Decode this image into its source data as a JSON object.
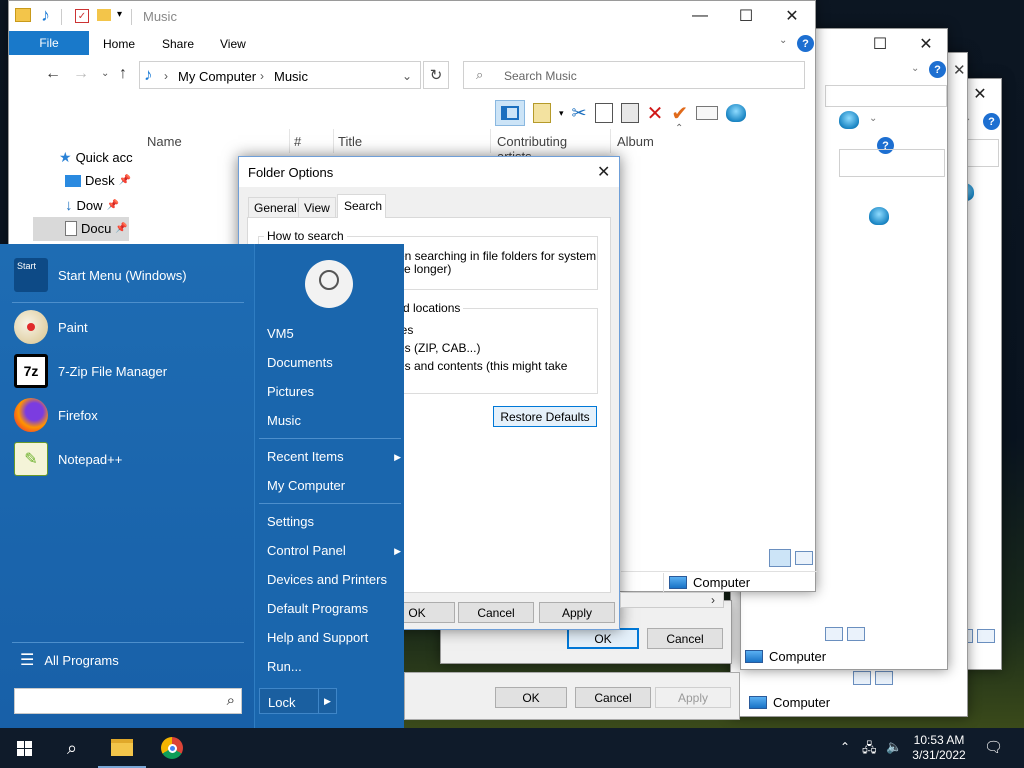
{
  "explorer": {
    "title": "Music",
    "menu": {
      "file": "File",
      "home": "Home",
      "share": "Share",
      "view": "View",
      "f": "F"
    },
    "breadcrumb": {
      "root": "My Computer",
      "current": "Music"
    },
    "search_placeholder": "Search Music",
    "columns": [
      "Name",
      "#",
      "Title",
      "Contributing artists",
      "Album"
    ],
    "nav": {
      "quick_access": "Quick acc",
      "desktop": "Desk",
      "downloads": "Dow",
      "documents": "Docu"
    },
    "status_computer": "Computer"
  },
  "back_windows": {
    "computer_1": "Computer",
    "computer_2": "Computer",
    "computer_3": "nputer",
    "ok": "OK",
    "cancel": "Cancel",
    "apply": "Apply",
    "ok_2": "OK",
    "cancel_2": "Cancel"
  },
  "folder_options": {
    "title": "Folder Options",
    "tabs": [
      "General",
      "View",
      "Search"
    ],
    "group1_title": "How to search",
    "group1_text1": "en searching in file folders for system",
    "group1_text2": "ke longer)",
    "group2_title": "d locations",
    "group2_line1": "ies",
    "group2_line2": "es (ZIP, CAB...)",
    "group2_line3": "es and contents (this might take",
    "restore_defaults": "Restore Defaults",
    "ok": "OK",
    "cancel": "Cancel",
    "apply": "Apply"
  },
  "start_menu": {
    "pinned": [
      {
        "label": "Start Menu (Windows)",
        "icon": "start-menu-icon"
      },
      {
        "label": "Paint",
        "icon": "paint-icon"
      },
      {
        "label": "7-Zip File Manager",
        "icon": "7zip-icon"
      },
      {
        "label": "Firefox",
        "icon": "firefox-icon"
      },
      {
        "label": "Notepad++",
        "icon": "notepadpp-icon"
      }
    ],
    "start_icon_text": "Start",
    "zip_icon_text": "7z",
    "all_programs": "All Programs",
    "right_links": [
      "VM5",
      "Documents",
      "Pictures",
      "Music",
      "Recent Items",
      "My Computer",
      "Settings",
      "Control Panel",
      "Devices and Printers",
      "Default Programs",
      "Help and Support",
      "Run..."
    ],
    "lock": "Lock",
    "search_value": ""
  },
  "taskbar": {
    "time": "10:53 AM",
    "date": "3/31/2022"
  },
  "colors": {
    "accent": "#0078d7",
    "start_bg": "#1561a6"
  }
}
